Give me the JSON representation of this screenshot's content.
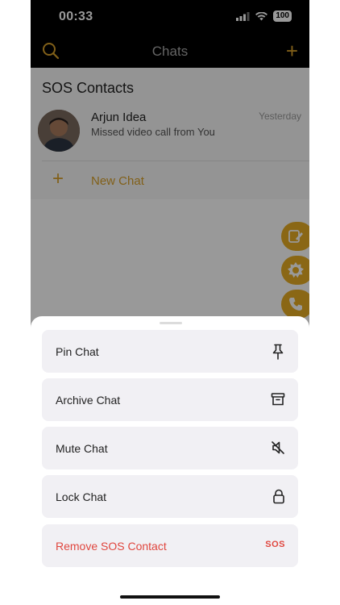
{
  "status_bar": {
    "time": "00:33",
    "battery": "100"
  },
  "header": {
    "title": "Chats"
  },
  "sos": {
    "section_title": "SOS Contacts",
    "contact": {
      "name": "Arjun Idea",
      "preview": "Missed video call from You",
      "time": "Yesterday"
    },
    "new_chat_label": "New Chat"
  },
  "sheet": {
    "actions": [
      {
        "label": "Pin Chat",
        "icon": "pin-icon"
      },
      {
        "label": "Archive Chat",
        "icon": "archive-icon"
      },
      {
        "label": "Mute Chat",
        "icon": "mute-icon"
      },
      {
        "label": "Lock Chat",
        "icon": "lock-icon"
      },
      {
        "label": "Remove SOS Contact",
        "badge": "SOS"
      }
    ]
  },
  "colors": {
    "accent": "#d8a02a",
    "fab": "#e6ac24",
    "danger": "#e0463e"
  }
}
